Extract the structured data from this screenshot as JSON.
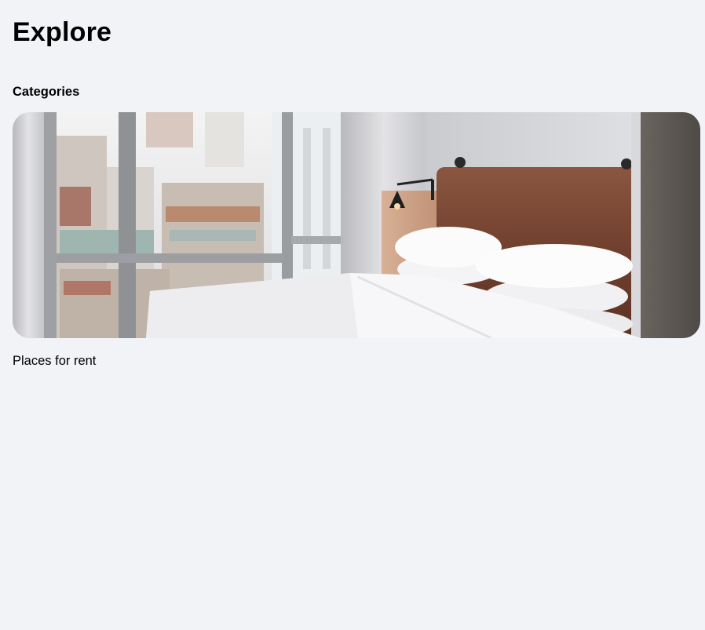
{
  "page": {
    "title": "Explore"
  },
  "categories": {
    "heading": "Categories",
    "items": [
      {
        "label": "Places for rent",
        "image": "bedroom-photo"
      }
    ]
  },
  "colors": {
    "background": "#f2f3f7",
    "text": "#000000"
  }
}
